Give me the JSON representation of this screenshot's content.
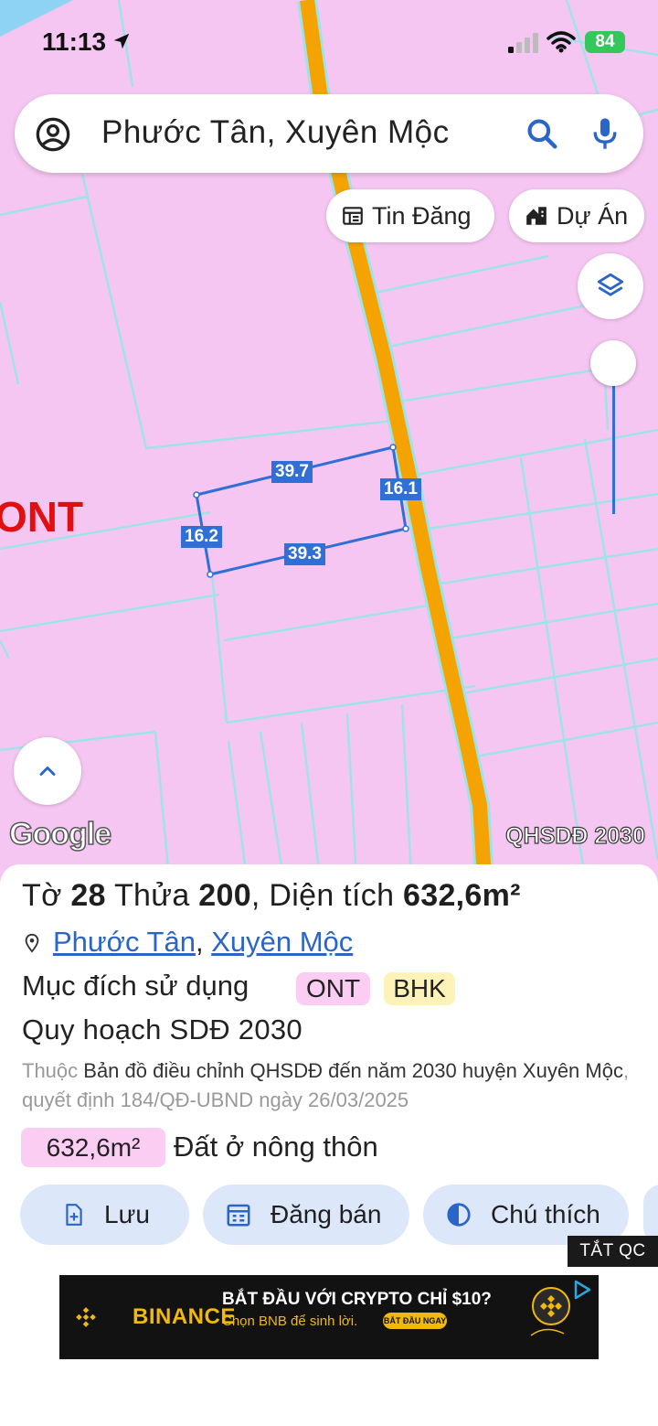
{
  "status_bar": {
    "time": "11:13",
    "battery": "84"
  },
  "search": {
    "text": "Phước Tân, Xuyên Mộc"
  },
  "chips": {
    "tin_dang": "Tin Đăng",
    "du_an": "Dự Án"
  },
  "map": {
    "zone_label": "ONT",
    "google_label": "Google",
    "layer_label": "QHSDĐ 2030",
    "dimensions": {
      "top": "39.7",
      "right": "16.1",
      "left": "16.2",
      "bottom": "39.3"
    },
    "colors": {
      "land": "#f6c6f2",
      "road": "#f4a300",
      "parcel": "#2f6fd6"
    }
  },
  "parcel": {
    "title_prefix": "Tờ ",
    "sheet": "28",
    "plot_prefix": " Thửa ",
    "plot": "200",
    "area_prefix": ", Diện tích ",
    "area": "632,6m²",
    "commune": "Phước Tân",
    "district": "Xuyên Mộc",
    "purpose_label": "Mục đích sử dụng",
    "purpose_tags": [
      "ONT",
      "BHK"
    ],
    "plan_label": "Quy hoạch SDĐ 2030",
    "desc_prefix": "Thuộc ",
    "desc_map": "Bản đồ điều chỉnh QHSDĐ đến năm 2030 huyện Xuyên Mộc",
    "desc_decision": ", quyết định 184/QĐ-UBND ngày 26/03/2025",
    "area_tag": "632,6m²",
    "land_type": "Đất ở nông thôn"
  },
  "actions": {
    "save": "Lưu",
    "post_sale": "Đăng bán",
    "legend": "Chú thích"
  },
  "ad": {
    "hide_label": "TẮT QC",
    "brand": "BINANCE",
    "headline": "BẮT ĐẦU VỚI CRYPTO CHỈ $10?",
    "subline": "Chọn BNB để sinh lời.",
    "cta": "BẮT ĐẦU NGAY"
  }
}
